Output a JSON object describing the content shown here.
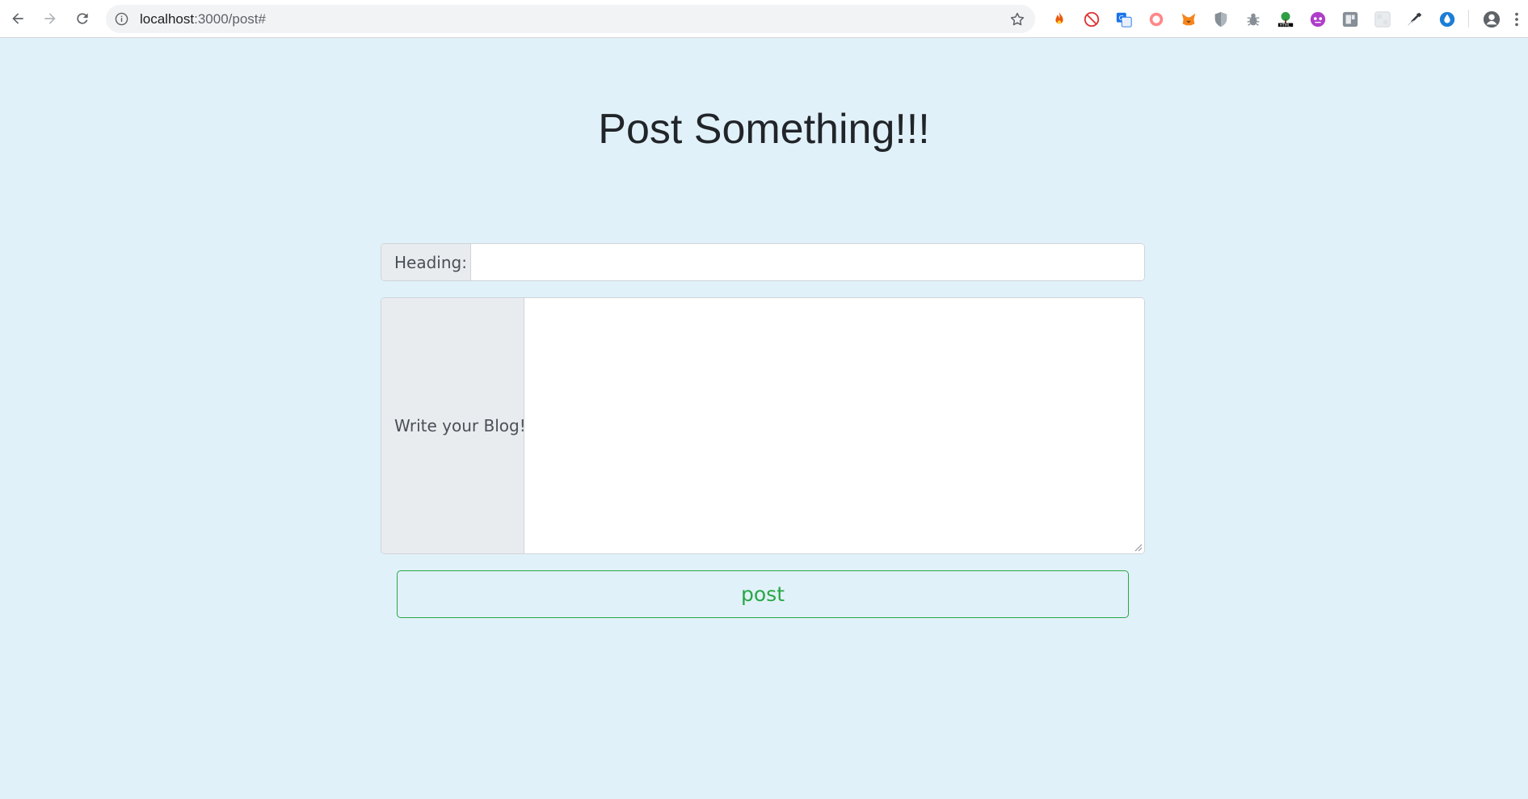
{
  "browser": {
    "url_host": "localhost",
    "url_path": ":3000/post#",
    "extensions": [
      {
        "name": "fire-extension-icon",
        "color": "#e8590c"
      },
      {
        "name": "adblock-extension-icon",
        "color": "#e03131"
      },
      {
        "name": "translate-extension-icon",
        "color": "#1a73e8"
      },
      {
        "name": "red-circle-extension-icon",
        "color": "#fa5252"
      },
      {
        "name": "metamask-extension-icon",
        "color": "#f6851b"
      },
      {
        "name": "shield-extension-icon",
        "color": "#868e96"
      },
      {
        "name": "bug-extension-icon",
        "color": "#868e96"
      },
      {
        "name": "html-tree-extension-icon",
        "color": "#2f9e44"
      },
      {
        "name": "purple-circle-extension-icon",
        "color": "#ae3ec9"
      },
      {
        "name": "gray-square-extension-icon",
        "color": "#868e96"
      },
      {
        "name": "light-square-extension-icon",
        "color": "#ced4da"
      },
      {
        "name": "eyedropper-extension-icon",
        "color": "#343a40"
      },
      {
        "name": "blue-drop-extension-icon",
        "color": "#1c7ed6"
      }
    ]
  },
  "page": {
    "title": "Post Something!!!",
    "heading_label": "Heading:",
    "heading_value": "",
    "blog_label": "Write your Blog!",
    "blog_value": "",
    "post_button": "post"
  },
  "colors": {
    "background": "#e1f1f9",
    "success": "#28a745",
    "addon_bg": "#e9ecef"
  }
}
